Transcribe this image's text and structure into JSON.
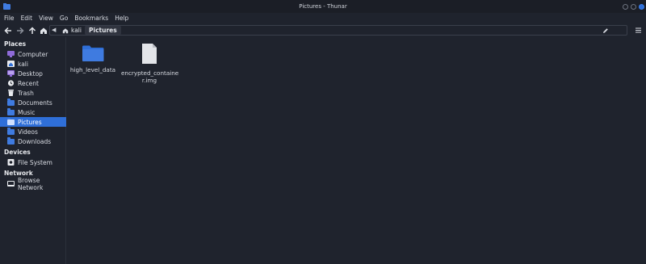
{
  "window": {
    "title": "Pictures - Thunar"
  },
  "menu": [
    "File",
    "Edit",
    "View",
    "Go",
    "Bookmarks",
    "Help"
  ],
  "toolbar": {
    "back_icon": "back-arrow-icon",
    "forward_icon": "forward-arrow-icon",
    "up_icon": "up-arrow-icon",
    "home_icon": "home-icon"
  },
  "path": {
    "home_label": "kali",
    "current": "Pictures"
  },
  "sidebar": {
    "places_title": "Places",
    "places": [
      {
        "label": "Computer",
        "icon": "computer-icon"
      },
      {
        "label": "kali",
        "icon": "home-folder-icon"
      },
      {
        "label": "Desktop",
        "icon": "desktop-icon"
      },
      {
        "label": "Recent",
        "icon": "recent-icon"
      },
      {
        "label": "Trash",
        "icon": "trash-icon"
      },
      {
        "label": "Documents",
        "icon": "folder-icon"
      },
      {
        "label": "Music",
        "icon": "folder-icon"
      },
      {
        "label": "Pictures",
        "icon": "folder-icon",
        "active": true
      },
      {
        "label": "Videos",
        "icon": "folder-icon"
      },
      {
        "label": "Downloads",
        "icon": "folder-icon"
      }
    ],
    "devices_title": "Devices",
    "devices": [
      {
        "label": "File System",
        "icon": "drive-icon"
      }
    ],
    "network_title": "Network",
    "network": [
      {
        "label": "Browse Network",
        "icon": "network-icon"
      }
    ]
  },
  "files": [
    {
      "name": "high_level_data",
      "type": "folder"
    },
    {
      "name_line1": "encrypted_containe",
      "name_line2": "r.img",
      "type": "file"
    }
  ],
  "colors": {
    "accent": "#2f6fd8",
    "background": "#1f232d",
    "folder": "#3f7be0"
  }
}
